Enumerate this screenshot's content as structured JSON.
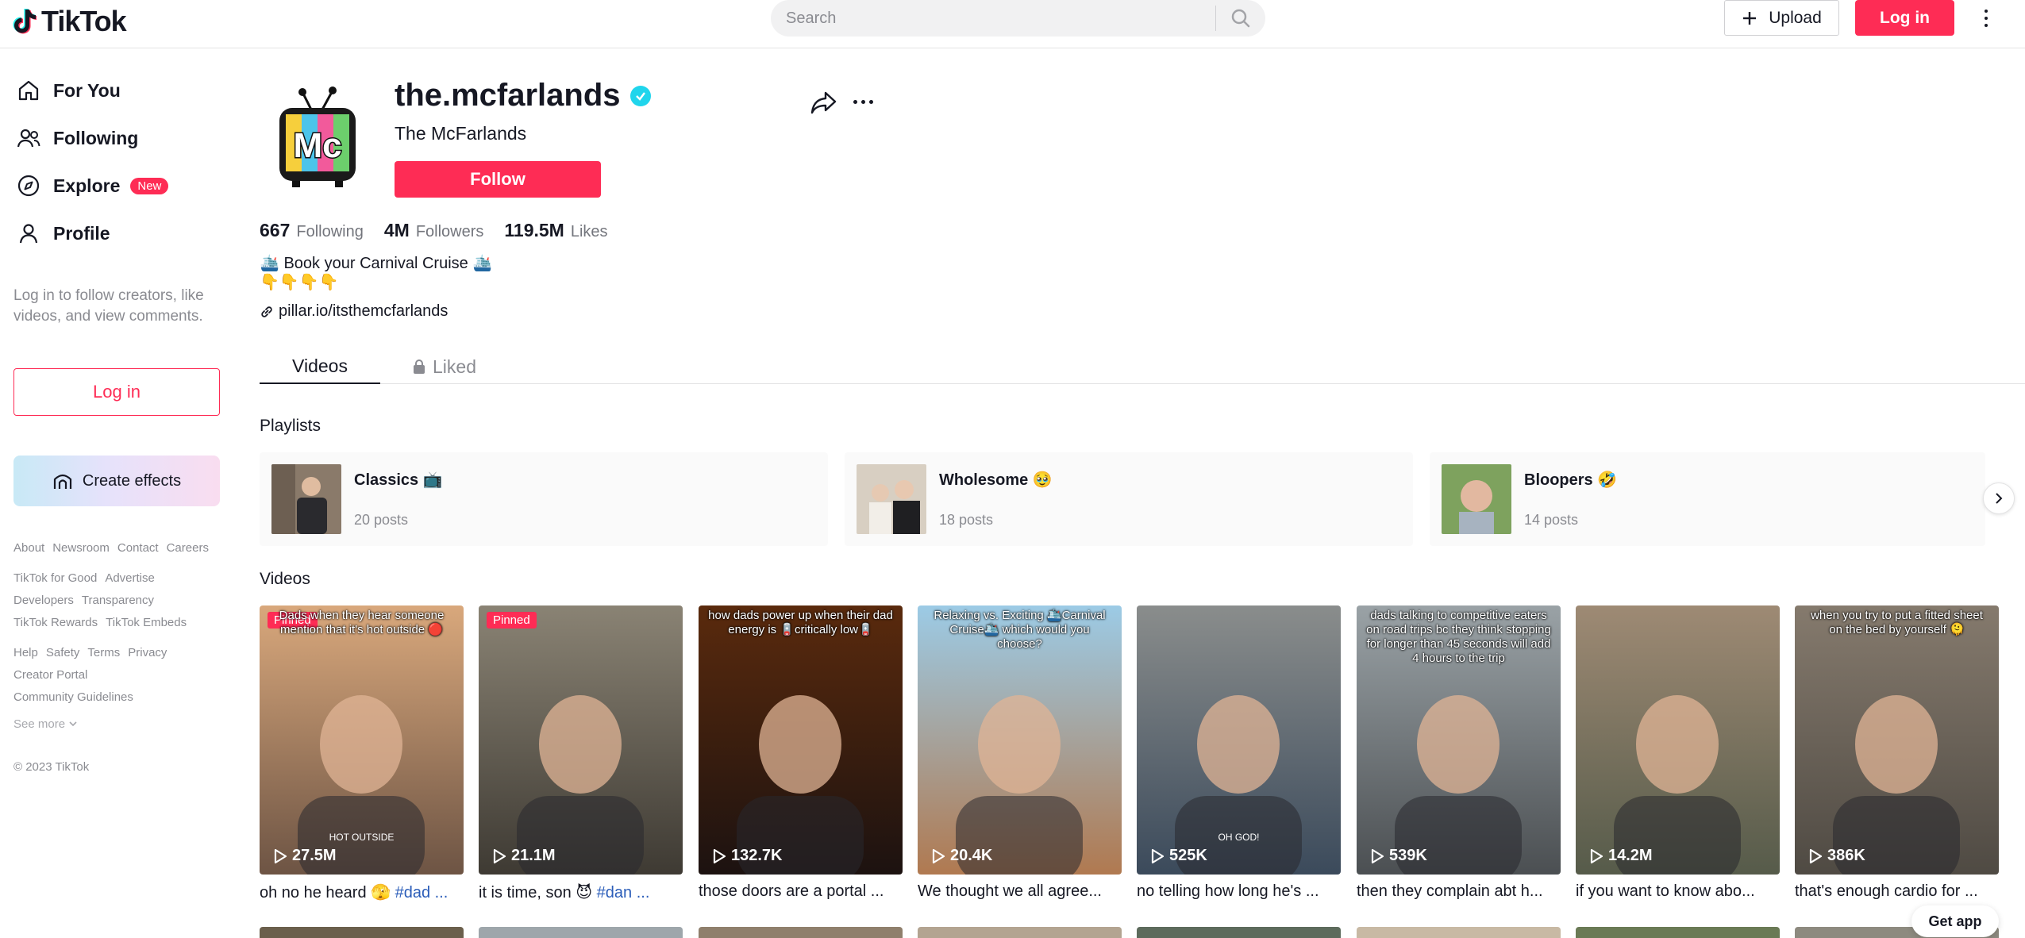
{
  "header": {
    "logo_text": "TikTok",
    "search_placeholder": "Search",
    "upload_label": "Upload",
    "login_label": "Log in"
  },
  "sidebar": {
    "nav": [
      {
        "label": "For You",
        "icon": "home-icon"
      },
      {
        "label": "Following",
        "icon": "following-icon"
      },
      {
        "label": "Explore",
        "icon": "compass-icon",
        "badge": "New"
      },
      {
        "label": "Profile",
        "icon": "person-icon"
      }
    ],
    "note": "Log in to follow creators, like videos, and view comments.",
    "login_label": "Log in",
    "create_effects_label": "Create effects",
    "footer_rows": [
      [
        "About",
        "Newsroom",
        "Contact",
        "Careers"
      ],
      [
        "TikTok for Good",
        "Advertise"
      ],
      [
        "Developers",
        "Transparency"
      ],
      [
        "TikTok Rewards",
        "TikTok Embeds"
      ],
      [
        "Help",
        "Safety",
        "Terms",
        "Privacy"
      ],
      [
        "Creator Portal"
      ],
      [
        "Community Guidelines"
      ]
    ],
    "see_more": "See more",
    "copyright": "© 2023 TikTok"
  },
  "profile": {
    "username": "the.mcfarlands",
    "display_name": "The McFarlands",
    "follow_label": "Follow",
    "stats": [
      {
        "value": "667",
        "label": "Following"
      },
      {
        "value": "4M",
        "label": "Followers"
      },
      {
        "value": "119.5M",
        "label": "Likes"
      }
    ],
    "bio_line1": "🛳️ Book your Carnival Cruise 🛳️",
    "bio_line2": "👇👇👇👇",
    "link": "pillar.io/itsthemcfarlands"
  },
  "tabs": {
    "videos": "Videos",
    "liked": "Liked"
  },
  "playlists_title": "Playlists",
  "playlists": [
    {
      "name": "Classics 📺",
      "count": "20 posts"
    },
    {
      "name": "Wholesome 🥹",
      "count": "18 posts"
    },
    {
      "name": "Bloopers 🤣",
      "count": "14 posts"
    }
  ],
  "videos_title": "Videos",
  "videos": [
    {
      "views": "27.5M",
      "pinned": "Pinned",
      "overlay": "Dads when they hear someone mention that it's hot outside 🔴",
      "bottom": "HOT OUTSIDE",
      "caption": "oh no he heard 🫣 ",
      "tag": "#dad ...",
      "colors": [
        "#d9a87c",
        "#6d5444"
      ]
    },
    {
      "views": "21.1M",
      "pinned": "Pinned",
      "overlay": "",
      "bottom": "",
      "caption": "it is time, son 😈 ",
      "tag": "#dan ...",
      "colors": [
        "#8a8374",
        "#3e3a33"
      ]
    },
    {
      "views": "132.7K",
      "pinned": "",
      "overlay": "how dads power up when their dad energy is 🪫critically low🪫",
      "bottom": "",
      "caption": "those doors are a portal ...",
      "tag": "",
      "colors": [
        "#5a2a0d",
        "#1c1210"
      ]
    },
    {
      "views": "20.4K",
      "pinned": "",
      "overlay": "Relaxing vs. Exciting 🛳️Carnival Cruise🛳️ which would you choose?",
      "bottom": "",
      "caption": "We thought we all agree...",
      "tag": "",
      "colors": [
        "#9ccbe6",
        "#b07950"
      ]
    },
    {
      "views": "525K",
      "pinned": "",
      "overlay": "",
      "bottom": "OH GOD!",
      "caption": "no telling how long he's ...",
      "tag": "",
      "colors": [
        "#8a8d8c",
        "#3b4a5b"
      ]
    },
    {
      "views": "539K",
      "pinned": "",
      "overlay": "dads talking to competitive eaters on road trips bc they think stopping for longer than 45 seconds will add 4 hours to the trip",
      "bottom": "",
      "caption": "then they complain abt h...",
      "tag": "",
      "colors": [
        "#9aa2a6",
        "#4b4f52"
      ]
    },
    {
      "views": "14.2M",
      "pinned": "",
      "overlay": "",
      "bottom": "",
      "caption": "if you want to know abo...",
      "tag": "",
      "colors": [
        "#9e8a74",
        "#565b4a"
      ]
    },
    {
      "views": "386K",
      "pinned": "",
      "overlay": "when you try to put a fitted sheet on the bed by yourself 🫠",
      "bottom": "",
      "caption": "that's enough cardio for ...",
      "tag": "",
      "colors": [
        "#857a6d",
        "#4f4a43"
      ]
    }
  ],
  "row2_colors": [
    "#6b5f4c",
    "#9ea6ab",
    "#8f7f6c",
    "#b3a491",
    "#5d6b5c",
    "#c8b9a4",
    "#6a7a55",
    "#8d8a7f"
  ],
  "get_app_label": "Get app",
  "colors": {
    "accent": "#fe2c55",
    "verified": "#20d5ec",
    "hashtag": "#2b5db9"
  }
}
